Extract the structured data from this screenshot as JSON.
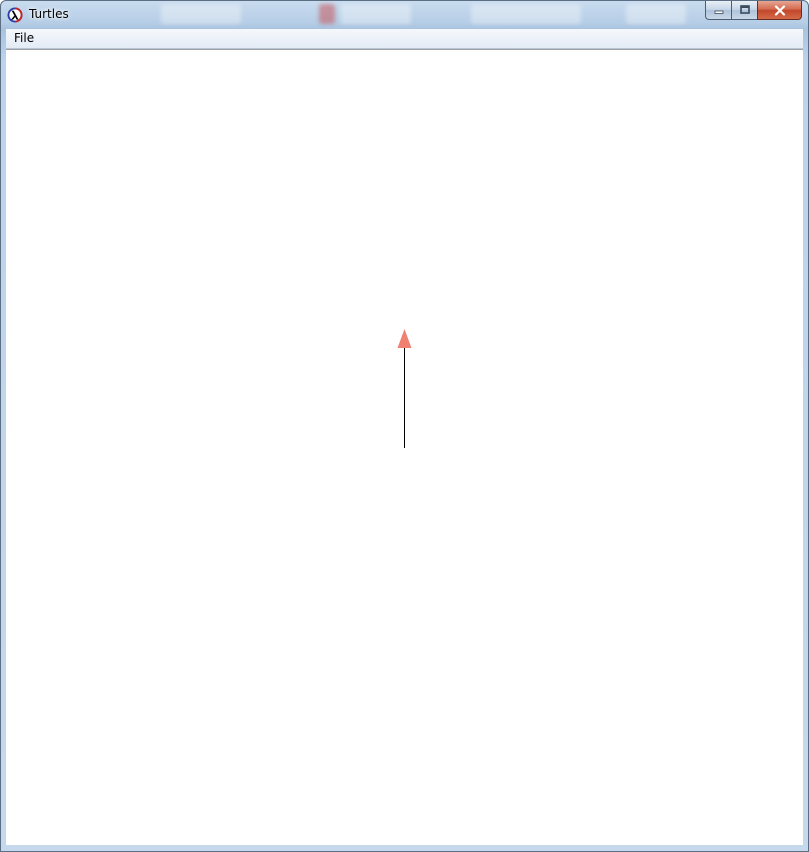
{
  "window": {
    "title": "Turtles",
    "icon": "racket-lambda-icon",
    "caption_buttons": [
      "minimize",
      "maximize",
      "close"
    ]
  },
  "menu": {
    "items": [
      {
        "label": "File"
      }
    ]
  },
  "canvas": {
    "background": "#ffffff",
    "turtle": {
      "color": "#f08070",
      "heading": "up",
      "pen_color": "#000000"
    }
  },
  "colors": {
    "titlebar": "#b5cde6",
    "close_button": "#c2472a"
  }
}
